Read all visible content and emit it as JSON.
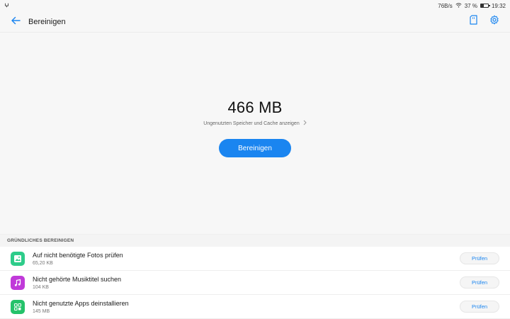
{
  "status_bar": {
    "left_icon": "usb-debug-icon",
    "network_speed": "76B/s",
    "battery_percent_text": "37 %",
    "battery_level": 0.37,
    "time": "19:32"
  },
  "toolbar": {
    "title": "Bereinigen",
    "back_icon": "back-arrow-icon",
    "sd_icon": "sd-card-icon",
    "settings_icon": "gear-icon"
  },
  "summary": {
    "size": "466 MB",
    "link_text": "Ungenutzten Speicher und Cache anzeigen",
    "clean_button_label": "Bereinigen"
  },
  "section": {
    "header": "GRÜNDLICHES BEREINIGEN",
    "items": [
      {
        "title": "Auf nicht benötigte Fotos prüfen",
        "size": "65,20 KB",
        "button": "Prüfen",
        "icon": "photo-icon",
        "color": "#2ecc8a"
      },
      {
        "title": "Nicht gehörte Musiktitel suchen",
        "size": "104 KB",
        "button": "Prüfen",
        "icon": "music-icon",
        "color": "#c03ad9"
      },
      {
        "title": "Nicht genutzte Apps deinstallieren",
        "size": "145 MB",
        "button": "Prüfen",
        "icon": "apps-icon",
        "color": "#24c26a"
      }
    ]
  },
  "colors": {
    "accent": "#1a85f0"
  }
}
